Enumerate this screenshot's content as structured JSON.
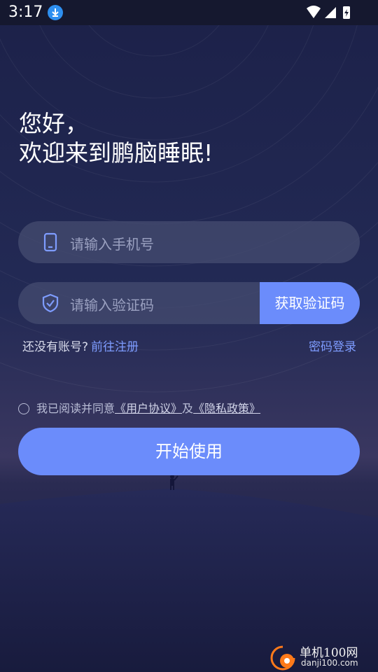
{
  "status": {
    "time": "3:17",
    "download_icon": "download-icon",
    "wifi_icon": "wifi-icon",
    "signal_icon": "signal-icon",
    "battery_icon": "battery-charging-icon"
  },
  "greeting": {
    "line1": "您好，",
    "line2": "欢迎来到鹏脑睡眠!"
  },
  "phone": {
    "icon": "phone-icon",
    "placeholder": "请输入手机号"
  },
  "code": {
    "icon": "shield-check-icon",
    "placeholder": "请输入验证码",
    "button": "获取验证码"
  },
  "links": {
    "no_account": "还没有账号?",
    "register": "前往注册",
    "password_login": "密码登录"
  },
  "agreement": {
    "prefix": "我已阅读并同意",
    "user_agreement": "《用户协议》",
    "and": "及",
    "privacy_policy": "《隐私政策》"
  },
  "start_button": "开始使用",
  "watermark": {
    "title": "单机100网",
    "url": "danji100.com"
  },
  "colors": {
    "accent": "#6b8cfb",
    "link": "#7e9cff",
    "background": "#1c2149"
  }
}
